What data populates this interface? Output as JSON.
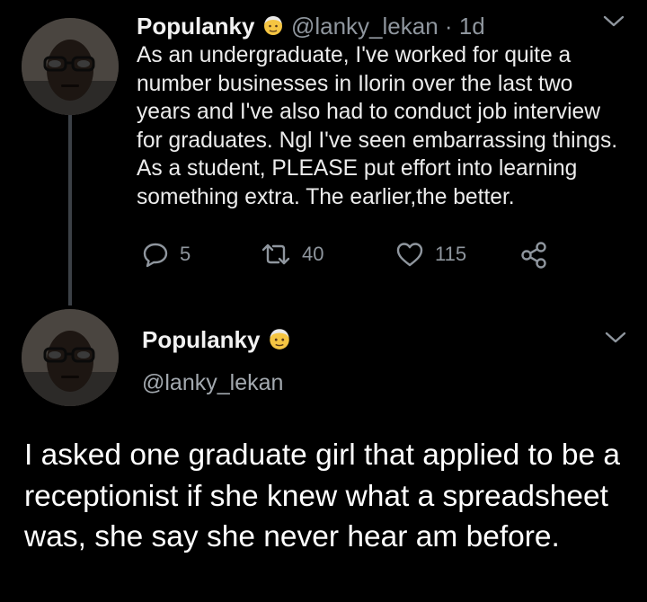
{
  "tweet1": {
    "display_name": "Populanky",
    "handle": "@lanky_lekan",
    "separator": "·",
    "time": "1d",
    "text": "As an undergraduate, I've worked for quite a number businesses in Ilorin over the last two years and I've also had to conduct job interview for graduates. Ngl I've seen embarrassing things. As a student, PLEASE put effort into learning something extra. The earlier,the better.",
    "reply_count": "5",
    "retweet_count": "40",
    "like_count": "115"
  },
  "tweet2": {
    "display_name": "Populanky",
    "handle": "@lanky_lekan",
    "text": "I asked one graduate girl that applied to be a receptionist if she knew what a spreadsheet was, she say she never hear am before."
  },
  "colors": {
    "background": "#000000",
    "secondary_text": "#8f969e",
    "thread_line": "#3b4046",
    "emoji": "#f5c542"
  },
  "icons": [
    "reply-icon",
    "retweet-icon",
    "like-icon",
    "share-icon",
    "chevron-down-icon",
    "old-man-emoji-icon"
  ]
}
